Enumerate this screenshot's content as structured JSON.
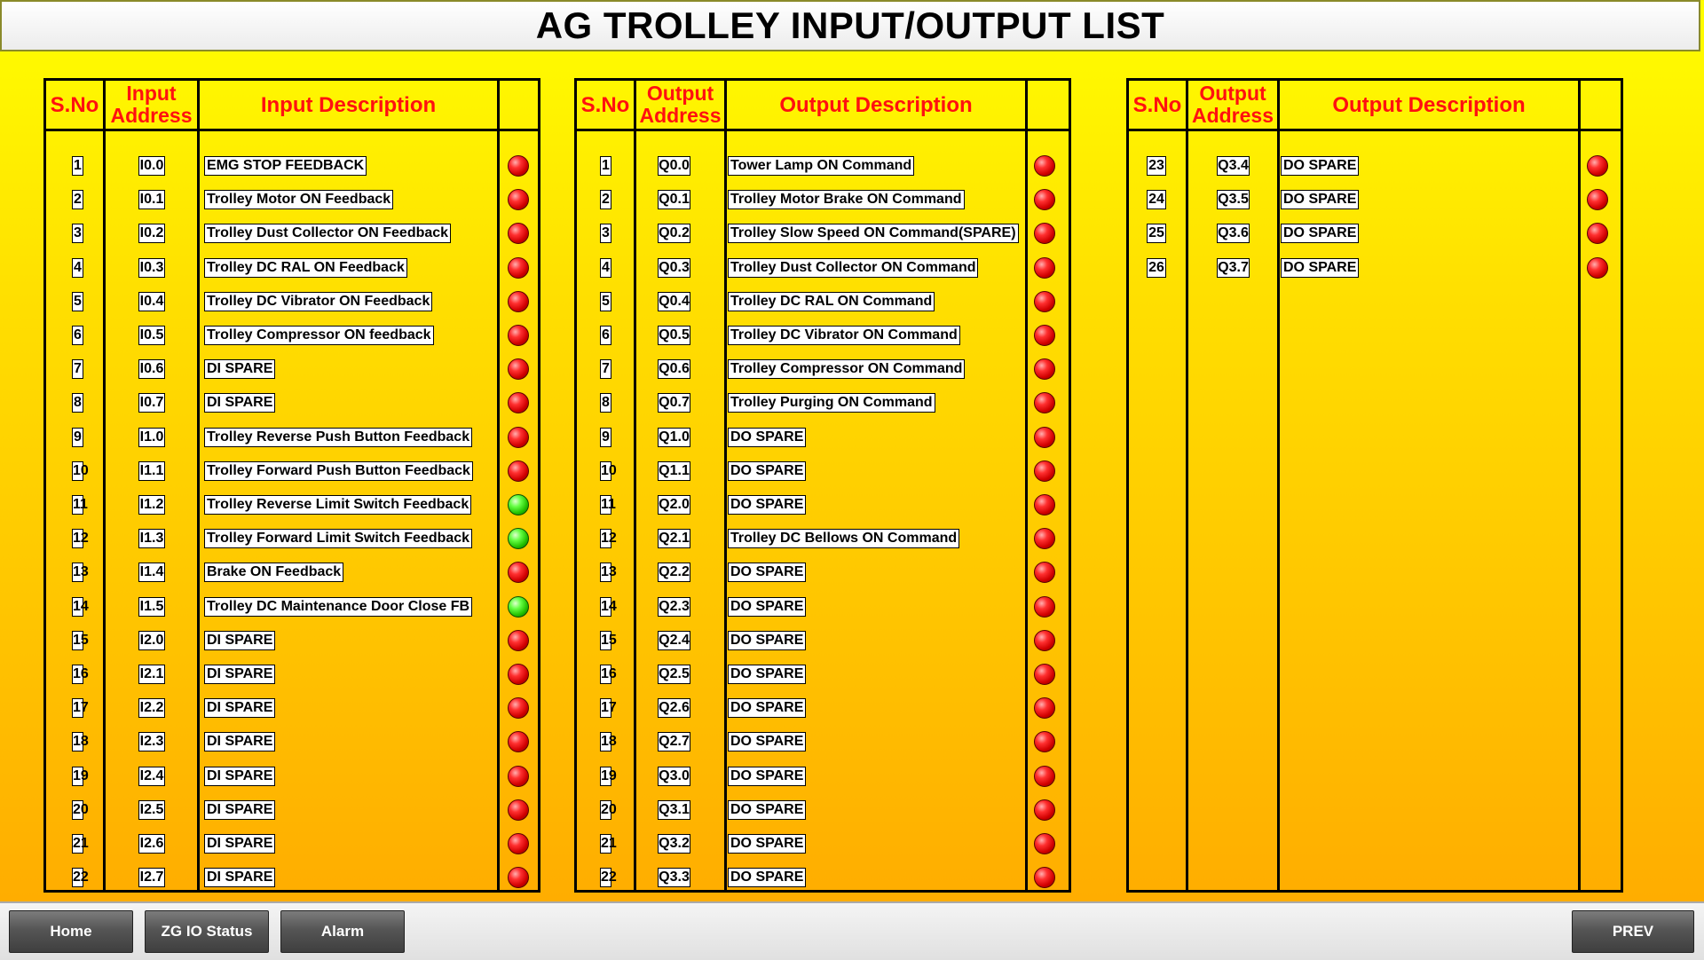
{
  "title": "AG TROLLEY INPUT/OUTPUT LIST",
  "colors": {
    "header_text": "#ff1010",
    "lamp_off": "#d00000",
    "lamp_on": "#22c000"
  },
  "panels": [
    {
      "headers": {
        "sno": "S.No",
        "addr1": "Input",
        "addr2": "Address",
        "desc": "Input Description"
      },
      "rows": [
        {
          "sno": "1",
          "addr": "I0.0",
          "desc": "EMG STOP FEEDBACK",
          "status": "red"
        },
        {
          "sno": "2",
          "addr": "I0.1",
          "desc": "Trolley Motor ON Feedback",
          "status": "red"
        },
        {
          "sno": "3",
          "addr": "I0.2",
          "desc": "Trolley Dust Collector ON Feedback",
          "status": "red"
        },
        {
          "sno": "4",
          "addr": "I0.3",
          "desc": "Trolley DC RAL ON Feedback",
          "status": "red"
        },
        {
          "sno": "5",
          "addr": "I0.4",
          "desc": "Trolley DC Vibrator ON Feedback",
          "status": "red"
        },
        {
          "sno": "6",
          "addr": "I0.5",
          "desc": "Trolley Compressor ON feedback",
          "status": "red"
        },
        {
          "sno": "7",
          "addr": "I0.6",
          "desc": "DI SPARE",
          "status": "red"
        },
        {
          "sno": "8",
          "addr": "I0.7",
          "desc": "DI SPARE",
          "status": "red"
        },
        {
          "sno": "9",
          "addr": "I1.0",
          "desc": "Trolley Reverse Push Button Feedback",
          "status": "red"
        },
        {
          "sno": "10",
          "addr": "I1.1",
          "desc": "Trolley Forward Push Button Feedback",
          "status": "red"
        },
        {
          "sno": "11",
          "addr": "I1.2",
          "desc": "Trolley Reverse Limit Switch Feedback",
          "status": "green"
        },
        {
          "sno": "12",
          "addr": "I1.3",
          "desc": "Trolley Forward Limit Switch Feedback",
          "status": "green"
        },
        {
          "sno": "13",
          "addr": "I1.4",
          "desc": "Brake ON Feedback",
          "status": "red"
        },
        {
          "sno": "14",
          "addr": "I1.5",
          "desc": "Trolley DC Maintenance Door Close FB",
          "status": "green"
        },
        {
          "sno": "15",
          "addr": "I2.0",
          "desc": "DI SPARE",
          "status": "red"
        },
        {
          "sno": "16",
          "addr": "I2.1",
          "desc": "DI SPARE",
          "status": "red"
        },
        {
          "sno": "17",
          "addr": "I2.2",
          "desc": "DI SPARE",
          "status": "red"
        },
        {
          "sno": "18",
          "addr": "I2.3",
          "desc": "DI SPARE",
          "status": "red"
        },
        {
          "sno": "19",
          "addr": "I2.4",
          "desc": "DI SPARE",
          "status": "red"
        },
        {
          "sno": "20",
          "addr": "I2.5",
          "desc": "DI SPARE",
          "status": "red"
        },
        {
          "sno": "21",
          "addr": "I2.6",
          "desc": "DI SPARE",
          "status": "red"
        },
        {
          "sno": "22",
          "addr": "I2.7",
          "desc": "DI SPARE",
          "status": "red"
        }
      ]
    },
    {
      "headers": {
        "sno": "S.No",
        "addr1": "Output",
        "addr2": "Address",
        "desc": "Output Description"
      },
      "rows": [
        {
          "sno": "1",
          "addr": "Q0.0",
          "desc": "Tower Lamp ON Command",
          "status": "red"
        },
        {
          "sno": "2",
          "addr": "Q0.1",
          "desc": "Trolley Motor Brake ON Command",
          "status": "red"
        },
        {
          "sno": "3",
          "addr": "Q0.2",
          "desc": "Trolley Slow Speed ON Command(SPARE)",
          "status": "red"
        },
        {
          "sno": "4",
          "addr": "Q0.3",
          "desc": "Trolley Dust Collector ON Command",
          "status": "red"
        },
        {
          "sno": "5",
          "addr": "Q0.4",
          "desc": "Trolley DC RAL ON Command",
          "status": "red"
        },
        {
          "sno": "6",
          "addr": "Q0.5",
          "desc": "Trolley DC Vibrator ON Command",
          "status": "red"
        },
        {
          "sno": "7",
          "addr": "Q0.6",
          "desc": "Trolley Compressor ON Command",
          "status": "red"
        },
        {
          "sno": "8",
          "addr": "Q0.7",
          "desc": "Trolley Purging ON Command",
          "status": "red"
        },
        {
          "sno": "9",
          "addr": "Q1.0",
          "desc": "DO SPARE",
          "status": "red"
        },
        {
          "sno": "10",
          "addr": "Q1.1",
          "desc": "DO SPARE",
          "status": "red"
        },
        {
          "sno": "11",
          "addr": "Q2.0",
          "desc": "DO SPARE",
          "status": "red"
        },
        {
          "sno": "12",
          "addr": "Q2.1",
          "desc": "Trolley DC Bellows ON Command",
          "status": "red"
        },
        {
          "sno": "13",
          "addr": "Q2.2",
          "desc": "DO SPARE",
          "status": "red"
        },
        {
          "sno": "14",
          "addr": "Q2.3",
          "desc": "DO SPARE",
          "status": "red"
        },
        {
          "sno": "15",
          "addr": "Q2.4",
          "desc": "DO SPARE",
          "status": "red"
        },
        {
          "sno": "16",
          "addr": "Q2.5",
          "desc": "DO SPARE",
          "status": "red"
        },
        {
          "sno": "17",
          "addr": "Q2.6",
          "desc": "DO SPARE",
          "status": "red"
        },
        {
          "sno": "18",
          "addr": "Q2.7",
          "desc": "DO SPARE",
          "status": "red"
        },
        {
          "sno": "19",
          "addr": "Q3.0",
          "desc": "DO SPARE",
          "status": "red"
        },
        {
          "sno": "20",
          "addr": "Q3.1",
          "desc": "DO SPARE",
          "status": "red"
        },
        {
          "sno": "21",
          "addr": "Q3.2",
          "desc": "DO SPARE",
          "status": "red"
        },
        {
          "sno": "22",
          "addr": "Q3.3",
          "desc": "DO SPARE",
          "status": "red"
        }
      ]
    },
    {
      "headers": {
        "sno": "S.No",
        "addr1": "Output",
        "addr2": "Address",
        "desc": "Output Description"
      },
      "rows": [
        {
          "sno": "23",
          "addr": "Q3.4",
          "desc": "DO SPARE",
          "status": "red"
        },
        {
          "sno": "24",
          "addr": "Q3.5",
          "desc": "DO SPARE",
          "status": "red"
        },
        {
          "sno": "25",
          "addr": "Q3.6",
          "desc": "DO SPARE",
          "status": "red"
        },
        {
          "sno": "26",
          "addr": "Q3.7",
          "desc": "DO SPARE",
          "status": "red"
        }
      ]
    }
  ],
  "footer": {
    "home": "Home",
    "zg_io_status": "ZG IO Status",
    "alarm": "Alarm",
    "prev": "PREV"
  }
}
